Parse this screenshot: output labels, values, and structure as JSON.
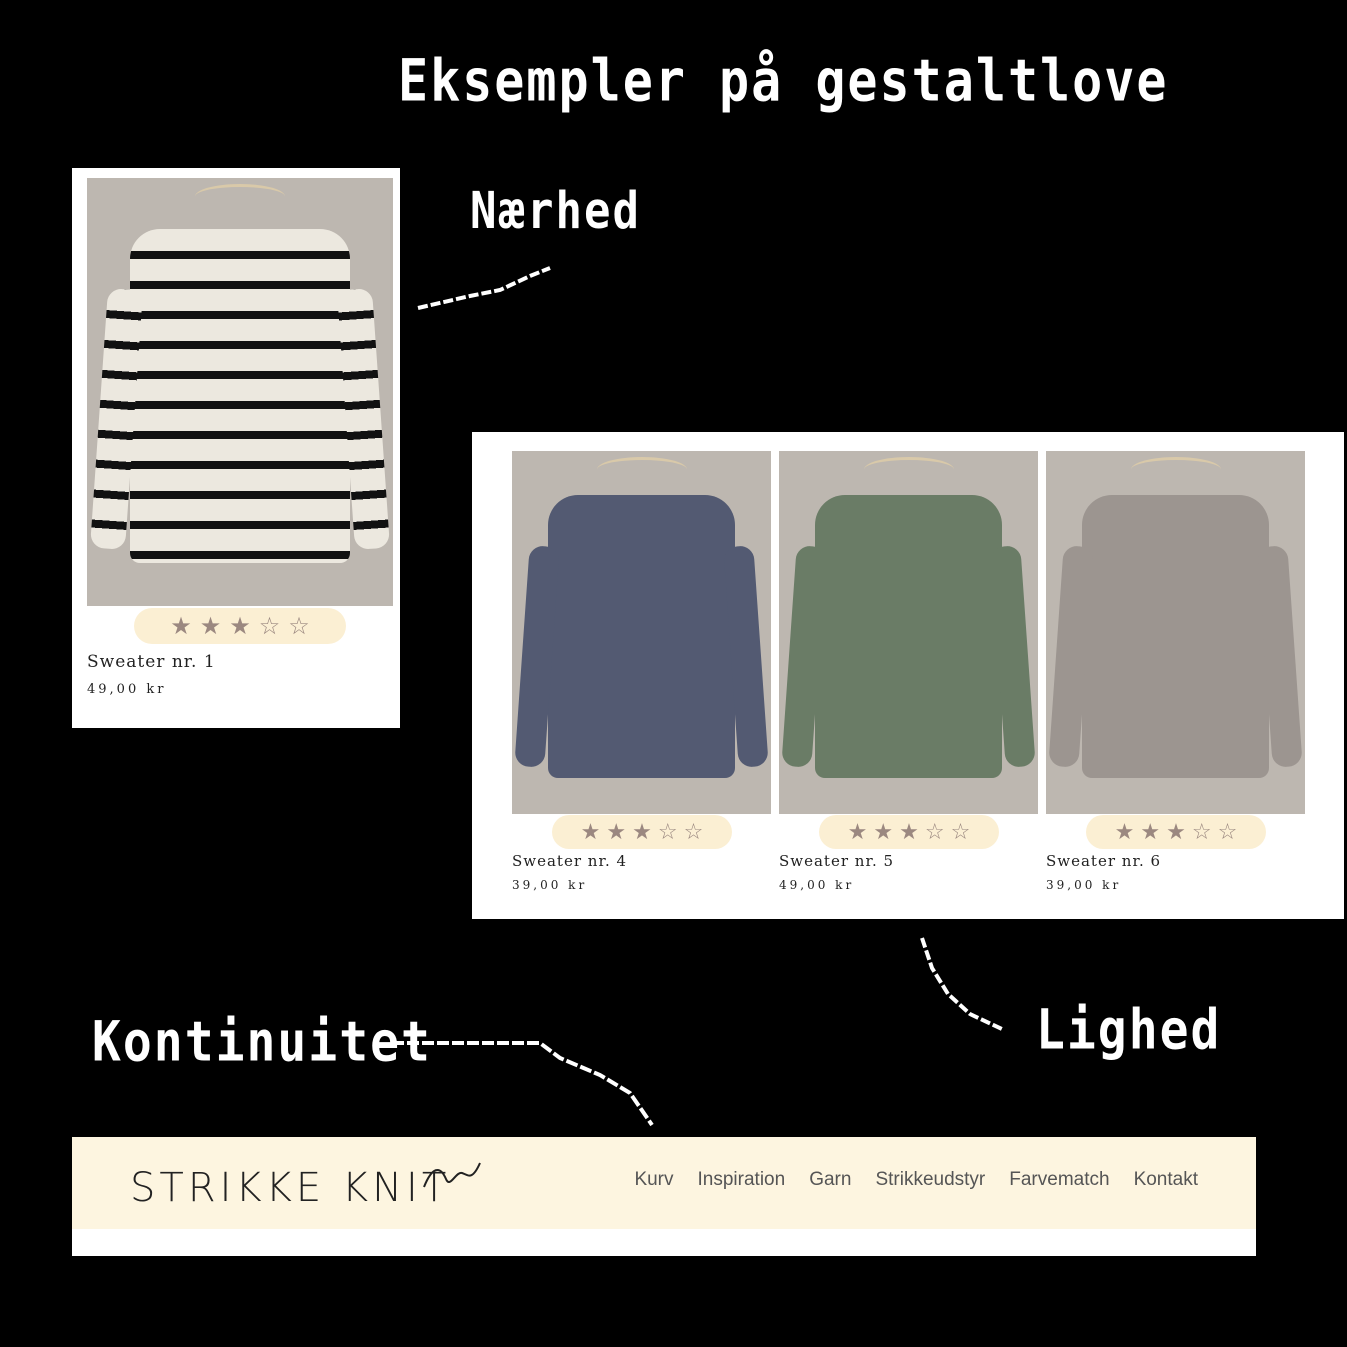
{
  "title": "Eksempler på gestaltlove",
  "labels": {
    "proximity": "Nærhed",
    "similarity": "Lighed",
    "continuity": "Kontinuitet"
  },
  "single_product": {
    "name": "Sweater nr. 1",
    "price": "49,00 kr",
    "rating": 3,
    "max_rating": 5,
    "colors": {
      "body": "#ece8df",
      "stripe": "#111111"
    }
  },
  "grid_products": [
    {
      "name": "Sweater nr. 4",
      "price": "39,00 kr",
      "rating": 3,
      "max_rating": 5,
      "color": "#535a72"
    },
    {
      "name": "Sweater nr. 5",
      "price": "49,00 kr",
      "rating": 3,
      "max_rating": 5,
      "color": "#6a7c66"
    },
    {
      "name": "Sweater nr. 6",
      "price": "39,00 kr",
      "rating": 3,
      "max_rating": 5,
      "color": "#9c9590"
    }
  ],
  "navbar": {
    "logo": "STRIKKE KNIT",
    "items": [
      "Kurv",
      "Inspiration",
      "Garn",
      "Strikkeudstyr",
      "Farvematch",
      "Kontakt"
    ]
  },
  "colors": {
    "background": "#000000",
    "rating_pill": "#fbefd3",
    "star": "#9b8880",
    "navbar": "#fdf5e0"
  }
}
